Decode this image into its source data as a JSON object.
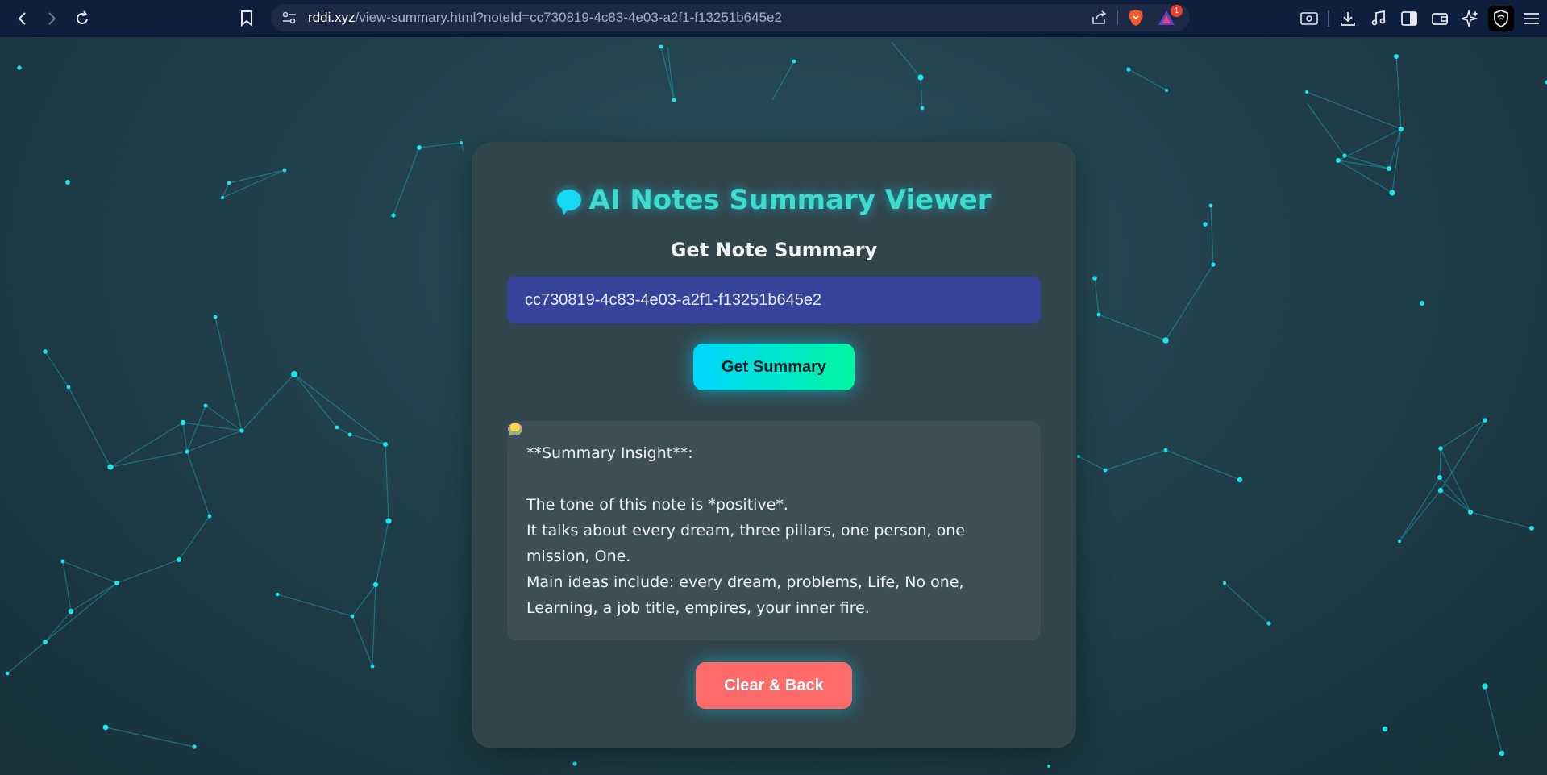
{
  "browser": {
    "url_host": "rddi.xyz",
    "url_path": "/view-summary.html?noteId=cc730819-4c83-4e03-a2f1-f13251b645e2",
    "notification_count": "1"
  },
  "page": {
    "title": "AI Notes Summary Viewer",
    "subtitle": "Get Note Summary",
    "note_id_value": "cc730819-4c83-4e03-a2f1-f13251b645e2",
    "get_button": "Get Summary",
    "summary": {
      "heading": "**Summary Insight**:",
      "tone": "The tone of this note is *positive*.",
      "topics": "It talks about every dream, three pillars, one person, one mission, One.",
      "main_ideas": "Main ideas include: every dream, problems, Life, No one, Learning, a job title, empires, your inner fire."
    },
    "clear_button": "Clear & Back"
  },
  "colors": {
    "accent_cyan": "#00d7ff",
    "accent_green": "#00f5a0",
    "clear_red": "#ff6b6b",
    "input_bg": "#37449a"
  }
}
